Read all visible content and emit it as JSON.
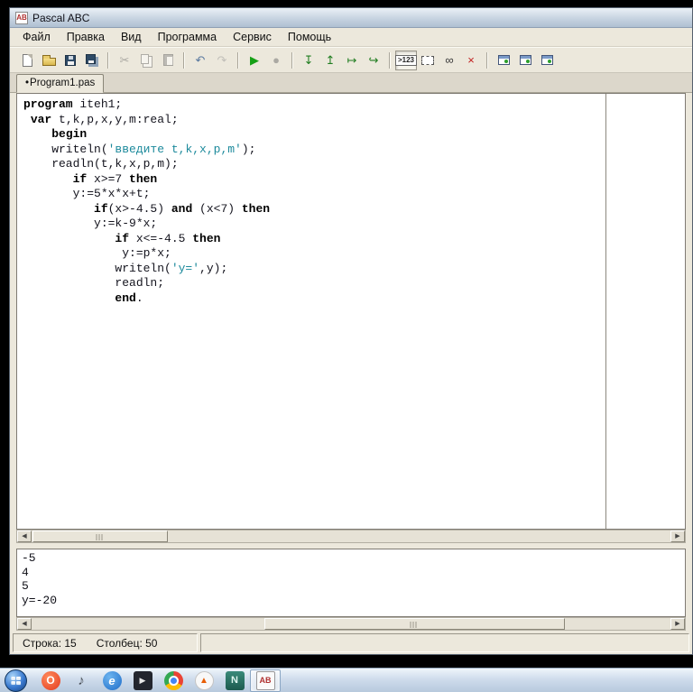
{
  "window": {
    "title": "Pascal ABC",
    "icon_label": "AB"
  },
  "menu": {
    "items": [
      "Файл",
      "Правка",
      "Вид",
      "Программа",
      "Сервис",
      "Помощь"
    ]
  },
  "toolbar": {
    "items": [
      {
        "name": "new-file-icon",
        "kind": "page"
      },
      {
        "name": "open-file-icon",
        "kind": "folder"
      },
      {
        "name": "save-icon",
        "kind": "floppy"
      },
      {
        "name": "save-all-icon",
        "kind": "floppy2"
      },
      {
        "sep": true
      },
      {
        "name": "cut-icon",
        "glyph": "✂",
        "color": "#5b6a78",
        "disabled": true
      },
      {
        "name": "copy-icon",
        "kind": "copy",
        "disabled": true
      },
      {
        "name": "paste-icon",
        "kind": "paste",
        "disabled": true
      },
      {
        "sep": true
      },
      {
        "name": "undo-icon",
        "glyph": "↶",
        "color": "#5b7aa0"
      },
      {
        "name": "redo-icon",
        "glyph": "↷",
        "color": "#8a97a5",
        "disabled": true
      },
      {
        "sep": true
      },
      {
        "name": "run-icon",
        "glyph": "▶",
        "color": "#16a016"
      },
      {
        "name": "stop-icon",
        "glyph": "●",
        "color": "#5f6e68",
        "disabled": true
      },
      {
        "sep": true
      },
      {
        "name": "step-into-icon",
        "glyph": "↧",
        "color": "#1f7d1f"
      },
      {
        "name": "step-out-icon",
        "glyph": "↥",
        "color": "#1f7d1f"
      },
      {
        "name": "step-over-icon",
        "glyph": "↦",
        "color": "#1f7d1f"
      },
      {
        "name": "run-to-cursor-icon",
        "glyph": "↪",
        "color": "#1f7d1f"
      },
      {
        "sep": true
      },
      {
        "name": "show-values-icon",
        "text": ">123",
        "pressed": true
      },
      {
        "name": "output-window-icon",
        "kind": "dashedbox"
      },
      {
        "name": "watch-window-icon",
        "glyph": "∞",
        "color": "#3a3a3a"
      },
      {
        "name": "clear-window-icon",
        "glyph": "×",
        "color": "#c22222"
      },
      {
        "sep": true
      },
      {
        "name": "module-window-1-icon",
        "kind": "appwindow"
      },
      {
        "name": "module-window-2-icon",
        "kind": "appwindow"
      },
      {
        "name": "module-window-3-icon",
        "kind": "appwindow"
      }
    ]
  },
  "tabs": [
    {
      "marker": "•",
      "label": "Program1.pas",
      "active": true
    }
  ],
  "editor": {
    "string_color": "#1d8a9c",
    "lines": [
      [
        {
          "t": "program",
          "s": "kw"
        },
        {
          "t": " iteh1;",
          "s": "n"
        }
      ],
      [
        {
          "t": " ",
          "s": "n"
        },
        {
          "t": "var",
          "s": "kw"
        },
        {
          "t": " t,k,p,x,y,m:real;",
          "s": "n"
        }
      ],
      [
        {
          "t": "    ",
          "s": "n"
        },
        {
          "t": "begin",
          "s": "kw"
        }
      ],
      [
        {
          "t": "    writeln(",
          "s": "n"
        },
        {
          "t": "'введите t,k,x,p,m'",
          "s": "str"
        },
        {
          "t": ");",
          "s": "n"
        }
      ],
      [
        {
          "t": "    readln(t,k,x,p,m);",
          "s": "n"
        }
      ],
      [
        {
          "t": "       ",
          "s": "n"
        },
        {
          "t": "if",
          "s": "kw"
        },
        {
          "t": " x>=7 ",
          "s": "n"
        },
        {
          "t": "then",
          "s": "kw"
        }
      ],
      [
        {
          "t": "       y:=5*x*x+t;",
          "s": "n"
        }
      ],
      [
        {
          "t": "          ",
          "s": "n"
        },
        {
          "t": "if",
          "s": "kw"
        },
        {
          "t": "(x>-4.5) ",
          "s": "n"
        },
        {
          "t": "and",
          "s": "kw"
        },
        {
          "t": " (x<7) ",
          "s": "n"
        },
        {
          "t": "then",
          "s": "kw"
        }
      ],
      [
        {
          "t": "          y:=k-9*x;",
          "s": "n"
        }
      ],
      [
        {
          "t": "             ",
          "s": "n"
        },
        {
          "t": "if",
          "s": "kw"
        },
        {
          "t": " x<=-4.5 ",
          "s": "n"
        },
        {
          "t": "then",
          "s": "kw"
        }
      ],
      [
        {
          "t": "              y:=p*x;",
          "s": "n"
        }
      ],
      [
        {
          "t": "             writeln(",
          "s": "n"
        },
        {
          "t": "'y='",
          "s": "str"
        },
        {
          "t": ",y);",
          "s": "n"
        }
      ],
      [
        {
          "t": "             readln;",
          "s": "n"
        }
      ],
      [
        {
          "t": "             ",
          "s": "n"
        },
        {
          "t": "end",
          "s": "kw"
        },
        {
          "t": ".",
          "s": "n"
        }
      ]
    ]
  },
  "output": {
    "lines": [
      "-5",
      "4",
      "5",
      "y=-20"
    ]
  },
  "status": {
    "line": "Строка: 15",
    "column": "Столбец: 50"
  },
  "taskbar": {
    "icons": [
      {
        "name": "opera-icon",
        "letter": "O"
      },
      {
        "name": "volume-mixer-icon",
        "letter": "♪"
      },
      {
        "name": "internet-explorer-icon",
        "letter": "e"
      },
      {
        "name": "media-player-icon",
        "letter": "▶"
      },
      {
        "name": "chrome-icon",
        "letter": ""
      },
      {
        "name": "vlc-icon",
        "letter": "▲"
      },
      {
        "name": "netbeans-icon",
        "letter": "N"
      },
      {
        "name": "pascal-abc-icon",
        "letter": "AB",
        "active": true
      }
    ]
  }
}
